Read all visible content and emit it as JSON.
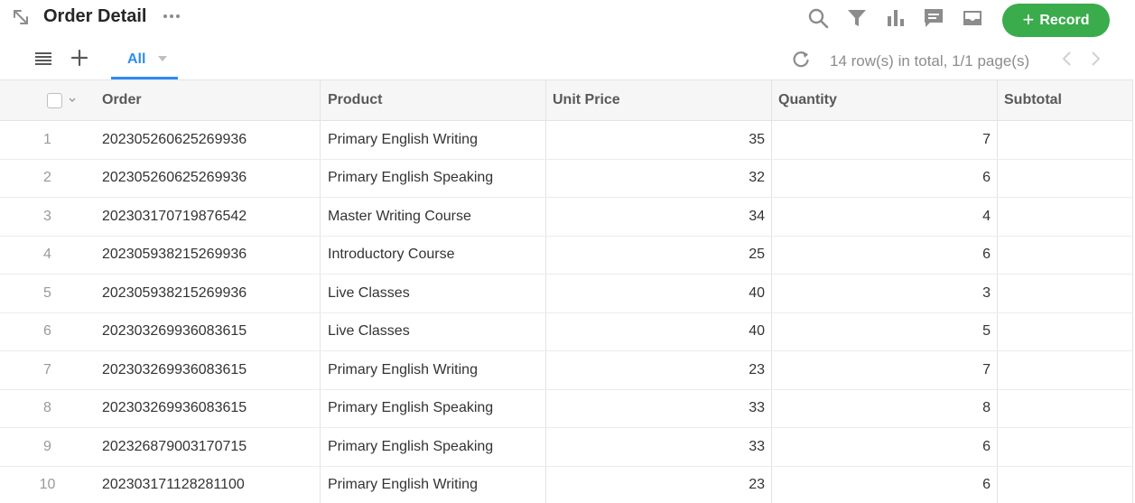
{
  "header": {
    "title": "Order Detail",
    "record_label": "Record",
    "icons": [
      "expand-icon",
      "more-icon",
      "search-icon",
      "filter-icon",
      "chart-icon",
      "comment-icon",
      "inbox-icon"
    ]
  },
  "toolbar": {
    "tab_label": "All",
    "page_info": "14 row(s) in total, 1/1 page(s)"
  },
  "table": {
    "columns": [
      "Order",
      "Product",
      "Unit Price",
      "Quantity",
      "Subtotal"
    ],
    "rows": [
      {
        "idx": "1",
        "order": "202305260625269936",
        "product": "Primary English Writing",
        "price": "35",
        "qty": "7",
        "subtotal": ""
      },
      {
        "idx": "2",
        "order": "202305260625269936",
        "product": "Primary English Speaking",
        "price": "32",
        "qty": "6",
        "subtotal": ""
      },
      {
        "idx": "3",
        "order": "202303170719876542",
        "product": "Master Writing Course",
        "price": "34",
        "qty": "4",
        "subtotal": ""
      },
      {
        "idx": "4",
        "order": "202305938215269936",
        "product": "Introductory Course",
        "price": "25",
        "qty": "6",
        "subtotal": ""
      },
      {
        "idx": "5",
        "order": "202305938215269936",
        "product": "Live Classes",
        "price": "40",
        "qty": "3",
        "subtotal": ""
      },
      {
        "idx": "6",
        "order": "202303269936083615",
        "product": "Live Classes",
        "price": "40",
        "qty": "5",
        "subtotal": ""
      },
      {
        "idx": "7",
        "order": "202303269936083615",
        "product": "Primary English Writing",
        "price": "23",
        "qty": "7",
        "subtotal": ""
      },
      {
        "idx": "8",
        "order": "202303269936083615",
        "product": "Primary English Speaking",
        "price": "33",
        "qty": "8",
        "subtotal": ""
      },
      {
        "idx": "9",
        "order": "202326879003170715",
        "product": "Primary English Speaking",
        "price": "33",
        "qty": "6",
        "subtotal": ""
      },
      {
        "idx": "10",
        "order": "202303171128281100",
        "product": "Primary English Writing",
        "price": "23",
        "qty": "6",
        "subtotal": ""
      }
    ]
  },
  "colors": {
    "accent": "#2d8cf0",
    "record": "#3aac4b",
    "icon": "#8c8c8c"
  }
}
